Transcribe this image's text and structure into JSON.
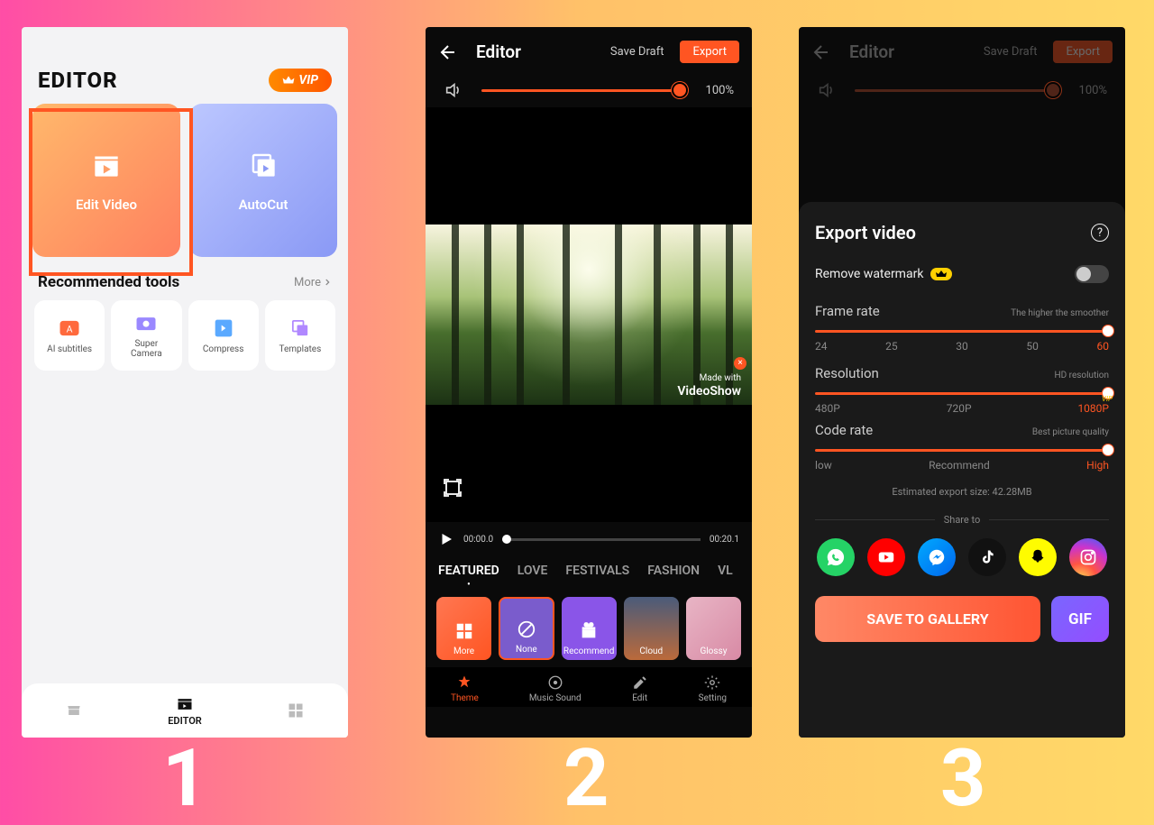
{
  "phone1": {
    "title": "EDITOR",
    "vip": "VIP",
    "edit_video": "Edit Video",
    "autocut": "AutoCut",
    "recommended": "Recommended tools",
    "more": "More",
    "tools": {
      "t0": "AI subtitles",
      "t1": "Super\nCamera",
      "t2": "Compress",
      "t3": "Templates"
    },
    "bottom": {
      "editor": "EDITOR"
    }
  },
  "phone2": {
    "title": "Editor",
    "save_draft": "Save Draft",
    "export": "Export",
    "vol_pct": "100%",
    "watermark_made": "Made with",
    "watermark_brand": "VideoShow",
    "time_start": "00:00.0",
    "time_end": "00:20.1",
    "cats": {
      "c0": "FEATURED",
      "c1": "LOVE",
      "c2": "FESTIVALS",
      "c3": "FASHION",
      "c4": "VL"
    },
    "themes": {
      "t0": "More",
      "t1": "None",
      "t2": "Recommend",
      "t3": "Cloud",
      "t4": "Glossy"
    },
    "bar": {
      "b0": "Theme",
      "b1": "Music Sound",
      "b2": "Edit",
      "b3": "Setting"
    }
  },
  "phone3": {
    "title": "Editor",
    "save_draft": "Save Draft",
    "export": "Export",
    "vol_pct": "100%",
    "sheet_title": "Export video",
    "remove_wm": "Remove watermark",
    "framerate": {
      "name": "Frame rate",
      "hint": "The higher the smoother",
      "l0": "24",
      "l1": "25",
      "l2": "30",
      "l3": "50",
      "l4": "60"
    },
    "resolution": {
      "name": "Resolution",
      "hint": "HD resolution",
      "l0": "480P",
      "l1": "720P",
      "l2": "1080P",
      "vip": "VIP"
    },
    "coderate": {
      "name": "Code rate",
      "hint": "Best picture quality",
      "l0": "low",
      "l1": "Recommend",
      "l2": "High"
    },
    "estimated": "Estimated export size: 42.28MB",
    "share_to": "Share to",
    "save_gallery": "SAVE TO GALLERY",
    "gif": "GIF"
  },
  "steps": {
    "s1": "1",
    "s2": "2",
    "s3": "3"
  }
}
